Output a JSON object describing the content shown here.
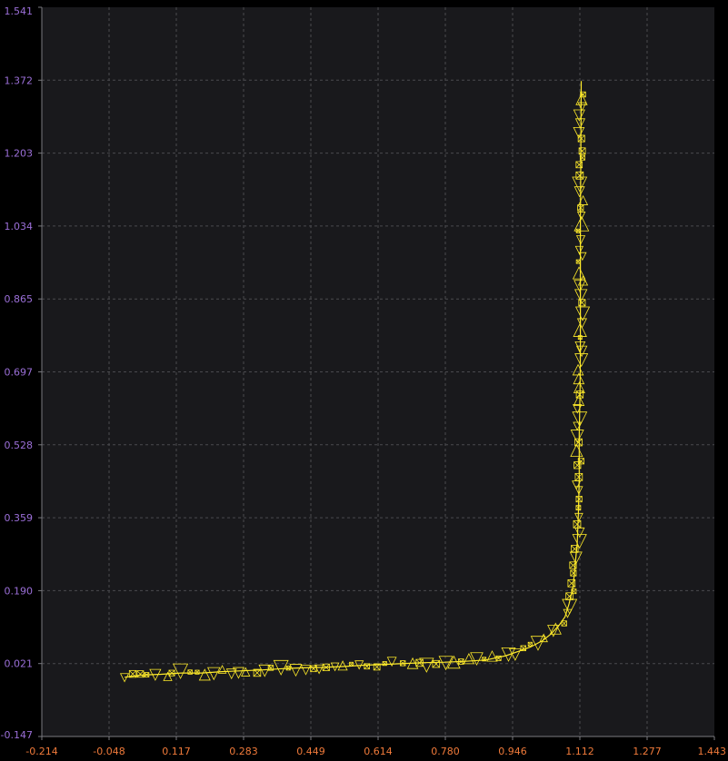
{
  "colors": {
    "background": "#000000",
    "plot_background": "#19191c",
    "grid": "#4a4a4e",
    "axis": "#7a7a80",
    "trace": "#ffeb2a",
    "y_tick_text": "#9b6fd8",
    "x_tick_text": "#f07a3a"
  },
  "chart_data": {
    "type": "line",
    "title": "",
    "xlabel": "",
    "ylabel": "",
    "grid": true,
    "grid_style": "dashed",
    "xlim": [
      -0.214,
      1.443
    ],
    "ylim": [
      -0.147,
      1.541
    ],
    "x_tick_labels": [
      "-0.214",
      "-0.048",
      "0.117",
      "0.283",
      "0.449",
      "0.614",
      "0.780",
      "0.946",
      "1.112",
      "1.277",
      "1.443"
    ],
    "y_tick_labels": [
      "1.541",
      "1.372",
      "1.203",
      "1.034",
      "0.865",
      "0.697",
      "0.528",
      "0.359",
      "0.190",
      "0.021",
      "-0.147"
    ],
    "marker": "triangles and crossed boxes along the trace (scribble style)",
    "series": [
      {
        "x": [
          -0.01,
          0.03,
          0.08,
          0.13,
          0.18,
          0.23,
          0.28,
          0.33,
          0.38,
          0.43,
          0.48,
          0.53,
          0.58,
          0.63,
          0.68,
          0.73,
          0.78,
          0.83,
          0.88,
          0.93,
          0.96,
          0.99,
          1.02,
          1.04,
          1.06,
          1.075,
          1.085,
          1.095,
          1.1,
          1.105,
          1.108,
          1.11,
          1.11,
          1.112,
          1.113,
          1.113,
          1.113,
          1.113,
          1.114,
          1.115
        ],
        "y": [
          -0.01,
          -0.005,
          -0.003,
          0.0,
          0.0,
          0.003,
          0.005,
          0.007,
          0.01,
          0.012,
          0.013,
          0.015,
          0.018,
          0.02,
          0.022,
          0.024,
          0.025,
          0.027,
          0.03,
          0.04,
          0.05,
          0.06,
          0.075,
          0.09,
          0.11,
          0.13,
          0.16,
          0.2,
          0.25,
          0.3,
          0.37,
          0.45,
          0.55,
          0.65,
          0.75,
          0.85,
          0.95,
          1.05,
          1.2,
          1.37
        ]
      }
    ]
  }
}
